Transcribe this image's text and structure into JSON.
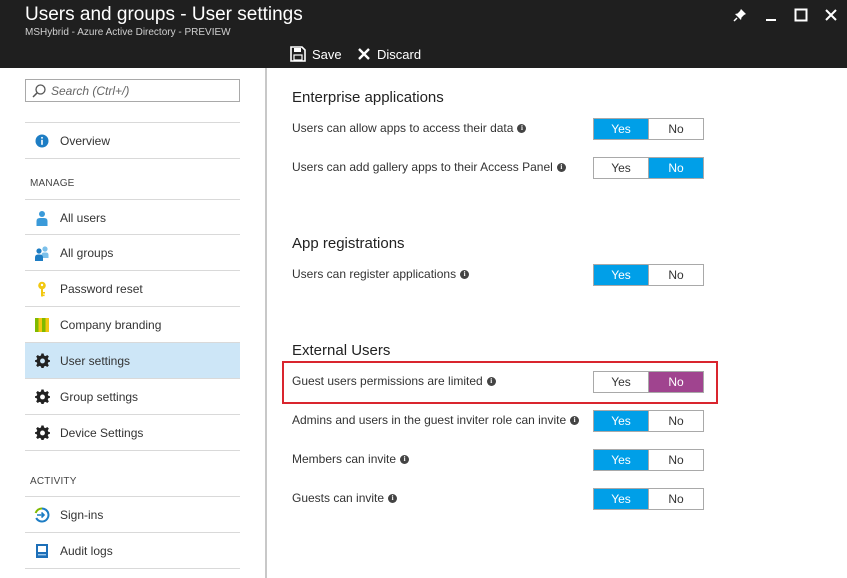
{
  "window": {
    "title": "Users and groups - User settings",
    "subtitle": "MSHybrid - Azure Active Directory - PREVIEW",
    "controls": [
      "pin-icon",
      "minimize-icon",
      "maximize-icon",
      "close-icon"
    ]
  },
  "toolbar": {
    "save_label": "Save",
    "discard_label": "Discard"
  },
  "search": {
    "placeholder": "Search (Ctrl+/)"
  },
  "nav": {
    "overview": "Overview",
    "manage_heading": "MANAGE",
    "manage_items": [
      {
        "label": "All users",
        "icon": "user-icon"
      },
      {
        "label": "All groups",
        "icon": "group-icon"
      },
      {
        "label": "Password reset",
        "icon": "key-icon"
      },
      {
        "label": "Company branding",
        "icon": "branding-icon"
      },
      {
        "label": "User settings",
        "icon": "gear-icon",
        "selected": true
      },
      {
        "label": "Group settings",
        "icon": "gear-icon"
      },
      {
        "label": "Device Settings",
        "icon": "gear-icon"
      }
    ],
    "activity_heading": "ACTIVITY",
    "activity_items": [
      {
        "label": "Sign-ins",
        "icon": "signin-icon"
      },
      {
        "label": "Audit logs",
        "icon": "audit-log-icon"
      }
    ]
  },
  "sections": {
    "enterprise": {
      "title": "Enterprise applications",
      "settings": [
        {
          "label": "Users can allow apps to access their data",
          "value": "Yes"
        },
        {
          "label": "Users can add gallery apps to their Access Panel",
          "value": "No"
        }
      ]
    },
    "app_registrations": {
      "title": "App registrations",
      "settings": [
        {
          "label": "Users can register applications",
          "value": "Yes"
        }
      ]
    },
    "external": {
      "title": "External Users",
      "settings": [
        {
          "label": "Guest users permissions are limited",
          "value": "No",
          "highlighted": true
        },
        {
          "label": "Admins and users in the guest inviter role can invite",
          "value": "Yes"
        },
        {
          "label": "Members can invite",
          "value": "Yes"
        },
        {
          "label": "Guests can invite",
          "value": "Yes"
        }
      ]
    }
  },
  "toggle_labels": {
    "yes": "Yes",
    "no": "No"
  },
  "colors": {
    "accent": "#009fe8",
    "highlight_active": "#a0448f",
    "selected_nav": "#cde6f7",
    "annotation_border": "#d9252e",
    "titlebar": "#1f1f1f"
  }
}
